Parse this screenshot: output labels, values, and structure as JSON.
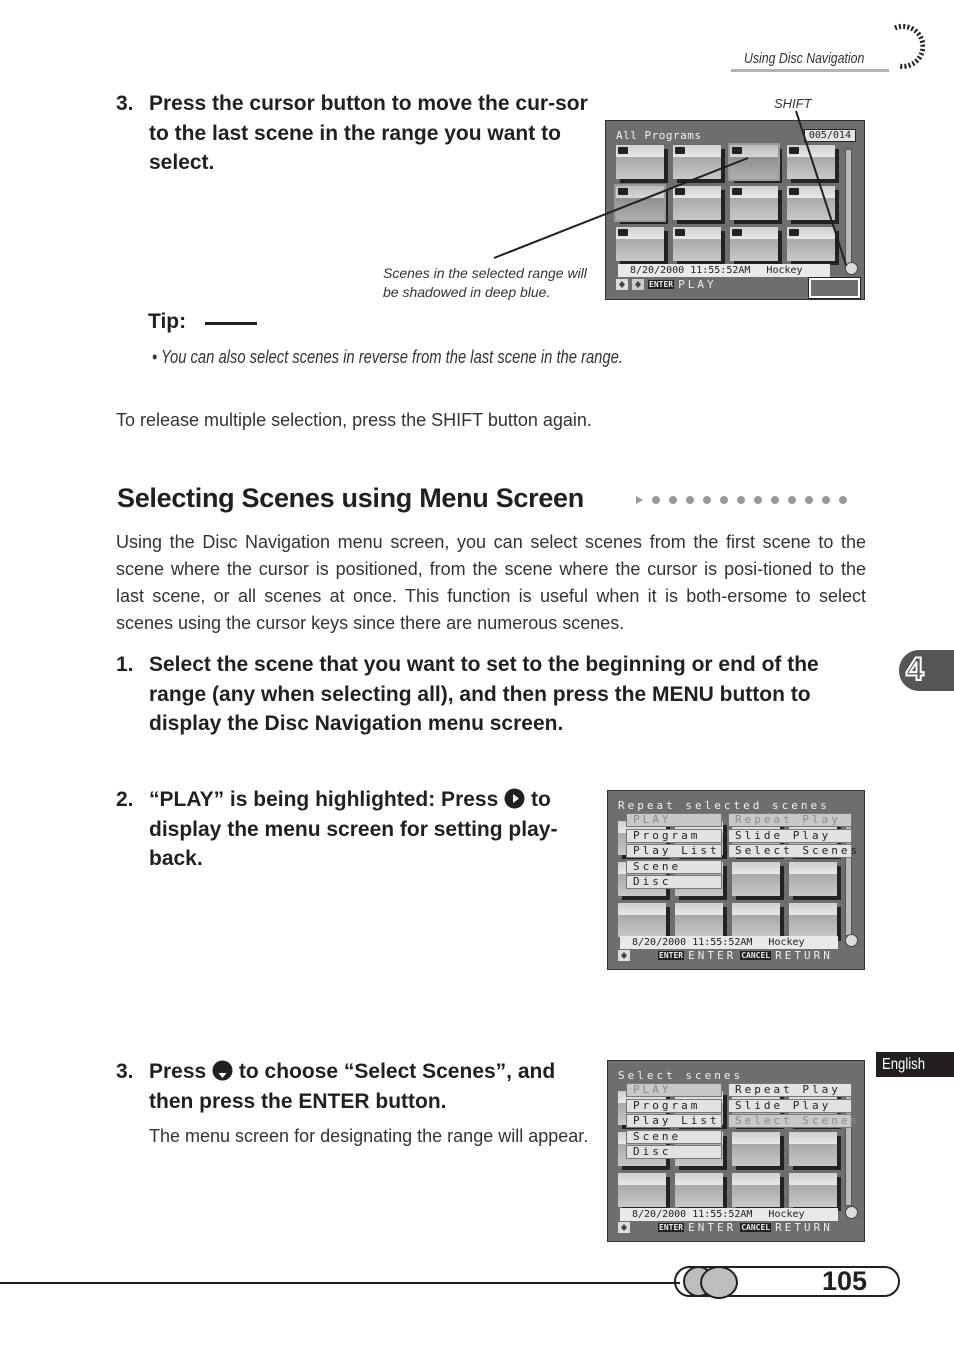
{
  "header": {
    "section": "Using Disc Navigation"
  },
  "top_step": {
    "number": "3.",
    "text": "Press the cursor button to move the cur-sor to the last scene in the range you want to select."
  },
  "figure1": {
    "callout_shift": "SHIFT",
    "callout_range": "Scenes in the selected range will be shadowed in deep blue.",
    "screen": {
      "title": "All Programs",
      "counter": "005/014",
      "date_time": "8/20/2000 11:55:52AM",
      "place": "Hockey",
      "enter_tag": "ENTER",
      "action": "PLAY"
    }
  },
  "tip": {
    "label": "Tip:",
    "bullet": "• You can also select scenes in reverse from the last scene in the range."
  },
  "release_note": "To release multiple selection, press the SHIFT button again.",
  "section": {
    "title": "Selecting Scenes using Menu Screen",
    "intro": "Using the Disc Navigation menu screen, you can select scenes from the first scene to the scene where the cursor is positioned, from the scene where the cursor is posi-tioned to the last scene, or all scenes at once. This function is useful when it is both-ersome to select scenes using the cursor keys since there are numerous scenes.",
    "steps": [
      {
        "number": "1.",
        "text": "Select the scene that you want to set to the beginning or end of the range (any when selecting all), and then press the MENU button to display the Disc Navigation menu screen."
      },
      {
        "number": "2.",
        "text_before": "“PLAY” is being highlighted: Press",
        "icon": "right-cursor-button-icon",
        "text_after": "to display the menu screen for setting play-back."
      },
      {
        "number": "3.",
        "text_before": "Press",
        "icon": "down-cursor-button-icon",
        "text_after": "to choose “Select Scenes”, and then press the ENTER button.",
        "note": "The menu screen for designating the range will appear."
      }
    ]
  },
  "figure2": {
    "title": "Repeat selected scenes",
    "left_menu": [
      "PLAY",
      "Program",
      "Play List",
      "Scene",
      "Disc"
    ],
    "right_menu": [
      "Repeat Play",
      "Slide Play",
      "Select Scenes"
    ],
    "date_time": "8/20/2000 11:55:52AM",
    "place": "Hockey",
    "enter_tag": "ENTER",
    "enter_label": "ENTER",
    "cancel_tag": "CANCEL",
    "cancel_label": "RETURN"
  },
  "figure3": {
    "title": "Select scenes",
    "left_menu": [
      "PLAY",
      "Program",
      "Play List",
      "Scene",
      "Disc"
    ],
    "right_menu": [
      "Repeat Play",
      "Slide Play",
      "Select Scenes"
    ],
    "date_time": "8/20/2000 11:55:52AM",
    "place": "Hockey",
    "enter_tag": "ENTER",
    "enter_label": "ENTER",
    "cancel_tag": "CANCEL",
    "cancel_label": "RETURN"
  },
  "side": {
    "chapter": "4",
    "language": "English"
  },
  "footer": {
    "page_number": "105"
  }
}
